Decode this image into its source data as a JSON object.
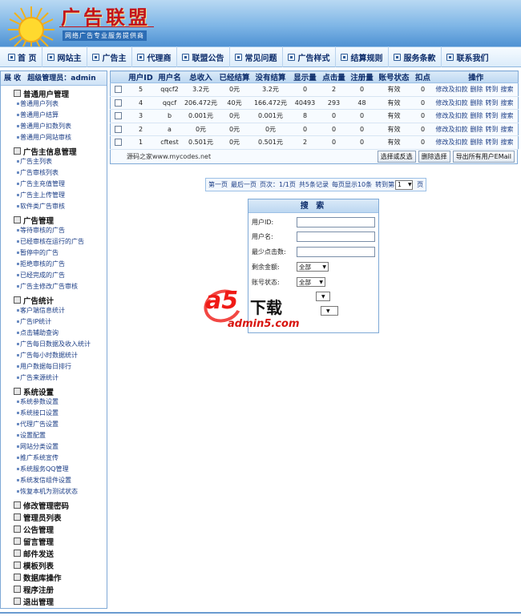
{
  "header": {
    "logo_title": "广告联盟",
    "logo_subtitle": "网络广告专业服务提供商"
  },
  "nav": [
    {
      "label": "首 页",
      "icon": "home-icon"
    },
    {
      "label": "网站主",
      "icon": "site-owner-icon"
    },
    {
      "label": "广告主",
      "icon": "advertiser-icon"
    },
    {
      "label": "代理商",
      "icon": "agent-icon"
    },
    {
      "label": "联盟公告",
      "icon": "notice-icon"
    },
    {
      "label": "常见问题",
      "icon": "faq-icon"
    },
    {
      "label": "广告样式",
      "icon": "ad-style-icon"
    },
    {
      "label": "结算规则",
      "icon": "settlement-icon"
    },
    {
      "label": "服务条款",
      "icon": "terms-icon"
    },
    {
      "label": "联系我们",
      "icon": "contact-icon"
    }
  ],
  "sidebar": {
    "collapse_label": "展 收",
    "admin_label": "超级管理员：admin",
    "groups": [
      {
        "title": "普通用户管理",
        "items": [
          "普通用户列表",
          "普通用户结算",
          "普通用户扣数列表",
          "普通用户网站审核"
        ]
      },
      {
        "title": "广告主信息管理",
        "items": [
          "广告主列表",
          "广告审核列表",
          "广告主充值管理",
          "广告主上传管理",
          "软件类广告审核"
        ]
      },
      {
        "title": "广告管理",
        "items": [
          "等待审核的广告",
          "已经审核在运行的广告",
          "暂停中的广告",
          "拒绝审核的广告",
          "已经完成的广告",
          "广告主修改广告审核"
        ]
      },
      {
        "title": "广告统计",
        "items": [
          "客户端信息统计",
          "广告IP统计",
          "点击辅助查询",
          "广告每日数据及收入统计",
          "广告每小时数据统计",
          "用户数据每日排行",
          "广告来源统计"
        ]
      },
      {
        "title": "系统设置",
        "items": [
          "系统参数设置",
          "系统接口设置",
          "代理广告设置",
          "设置配置",
          "网站分类设置",
          "推广系统宣传",
          "系统服务QQ管理",
          "系统发信组件设置",
          "恢复本机为测试状态"
        ]
      }
    ],
    "singles": [
      "修改管理密码",
      "管理员列表",
      "公告管理",
      "留言管理",
      "邮件发送",
      "模板列表",
      "数据库操作",
      "程序注册",
      "退出管理"
    ]
  },
  "table": {
    "columns": [
      "",
      "用户ID",
      "用户名",
      "总收入",
      "已经结算",
      "没有结算",
      "显示量",
      "点击量",
      "注册量",
      "账号状态",
      "扣点",
      "操作"
    ],
    "rows": [
      {
        "id": "5",
        "name": "qqcf2",
        "total": "3.2元",
        "settled": "0元",
        "unsettled": "3.2元",
        "views": "0",
        "clicks": "2",
        "regs": "0",
        "status": "有效",
        "deduct": "0"
      },
      {
        "id": "4",
        "name": "qqcf",
        "total": "206.472元",
        "settled": "40元",
        "unsettled": "166.472元",
        "views": "40493",
        "clicks": "293",
        "regs": "48",
        "status": "有效",
        "deduct": "0"
      },
      {
        "id": "3",
        "name": "b",
        "total": "0.001元",
        "settled": "0元",
        "unsettled": "0.001元",
        "views": "8",
        "clicks": "0",
        "regs": "0",
        "status": "有效",
        "deduct": "0"
      },
      {
        "id": "2",
        "name": "a",
        "total": "0元",
        "settled": "0元",
        "unsettled": "0元",
        "views": "0",
        "clicks": "0",
        "regs": "0",
        "status": "有效",
        "deduct": "0"
      },
      {
        "id": "1",
        "name": "cftest",
        "total": "0.501元",
        "settled": "0元",
        "unsettled": "0.501元",
        "views": "2",
        "clicks": "0",
        "regs": "0",
        "status": "有效",
        "deduct": "0"
      }
    ],
    "ops": [
      "修改及扣款",
      "删除",
      "转到",
      "搜索"
    ],
    "footer_text": "源码之家www.mycodes.net",
    "buttons": [
      "选择或反选",
      "删除选择",
      "导出所有用户EMail"
    ]
  },
  "pager": {
    "first": "第一页",
    "last": "最后一页",
    "pages": "页次：1/1页",
    "records": "共5条记录",
    "per_page": "每页显示10条",
    "goto": "转到第",
    "page_value": "1",
    "page_suffix": "页"
  },
  "search": {
    "title": "搜 索",
    "user_id_label": "用户ID:",
    "username_label": "用户名:",
    "min_clicks_label": "最少点击数:",
    "balance_label": "剩余金额:",
    "balance_value": "全部",
    "status_label": "账号状态:",
    "status_value": "全部"
  },
  "watermark": {
    "a5": "a5",
    "dl": "下载",
    "url": "admin5.com"
  }
}
